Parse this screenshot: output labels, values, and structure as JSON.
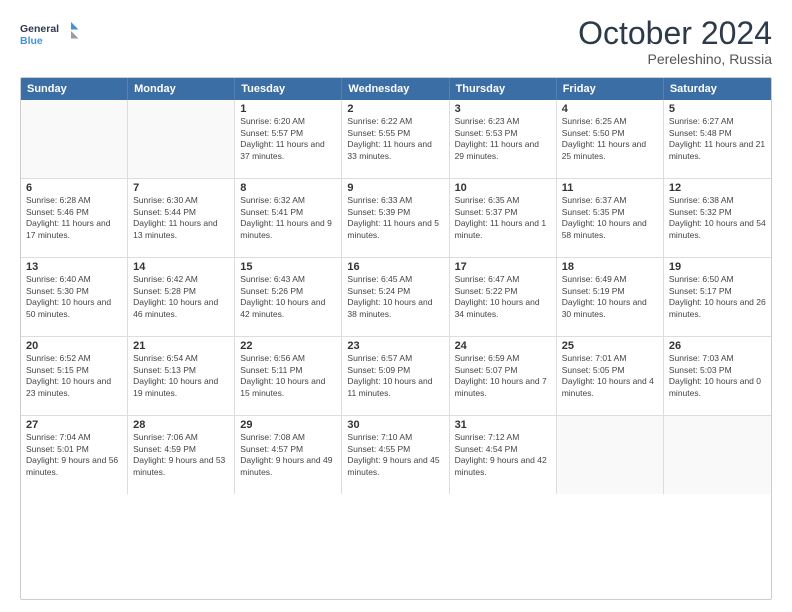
{
  "logo": {
    "line1": "General",
    "line2": "Blue"
  },
  "header": {
    "month": "October 2024",
    "location": "Pereleshino, Russia"
  },
  "days_of_week": [
    "Sunday",
    "Monday",
    "Tuesday",
    "Wednesday",
    "Thursday",
    "Friday",
    "Saturday"
  ],
  "weeks": [
    [
      {
        "day": "",
        "sunrise": "",
        "sunset": "",
        "daylight": ""
      },
      {
        "day": "",
        "sunrise": "",
        "sunset": "",
        "daylight": ""
      },
      {
        "day": "1",
        "sunrise": "Sunrise: 6:20 AM",
        "sunset": "Sunset: 5:57 PM",
        "daylight": "Daylight: 11 hours and 37 minutes."
      },
      {
        "day": "2",
        "sunrise": "Sunrise: 6:22 AM",
        "sunset": "Sunset: 5:55 PM",
        "daylight": "Daylight: 11 hours and 33 minutes."
      },
      {
        "day": "3",
        "sunrise": "Sunrise: 6:23 AM",
        "sunset": "Sunset: 5:53 PM",
        "daylight": "Daylight: 11 hours and 29 minutes."
      },
      {
        "day": "4",
        "sunrise": "Sunrise: 6:25 AM",
        "sunset": "Sunset: 5:50 PM",
        "daylight": "Daylight: 11 hours and 25 minutes."
      },
      {
        "day": "5",
        "sunrise": "Sunrise: 6:27 AM",
        "sunset": "Sunset: 5:48 PM",
        "daylight": "Daylight: 11 hours and 21 minutes."
      }
    ],
    [
      {
        "day": "6",
        "sunrise": "Sunrise: 6:28 AM",
        "sunset": "Sunset: 5:46 PM",
        "daylight": "Daylight: 11 hours and 17 minutes."
      },
      {
        "day": "7",
        "sunrise": "Sunrise: 6:30 AM",
        "sunset": "Sunset: 5:44 PM",
        "daylight": "Daylight: 11 hours and 13 minutes."
      },
      {
        "day": "8",
        "sunrise": "Sunrise: 6:32 AM",
        "sunset": "Sunset: 5:41 PM",
        "daylight": "Daylight: 11 hours and 9 minutes."
      },
      {
        "day": "9",
        "sunrise": "Sunrise: 6:33 AM",
        "sunset": "Sunset: 5:39 PM",
        "daylight": "Daylight: 11 hours and 5 minutes."
      },
      {
        "day": "10",
        "sunrise": "Sunrise: 6:35 AM",
        "sunset": "Sunset: 5:37 PM",
        "daylight": "Daylight: 11 hours and 1 minute."
      },
      {
        "day": "11",
        "sunrise": "Sunrise: 6:37 AM",
        "sunset": "Sunset: 5:35 PM",
        "daylight": "Daylight: 10 hours and 58 minutes."
      },
      {
        "day": "12",
        "sunrise": "Sunrise: 6:38 AM",
        "sunset": "Sunset: 5:32 PM",
        "daylight": "Daylight: 10 hours and 54 minutes."
      }
    ],
    [
      {
        "day": "13",
        "sunrise": "Sunrise: 6:40 AM",
        "sunset": "Sunset: 5:30 PM",
        "daylight": "Daylight: 10 hours and 50 minutes."
      },
      {
        "day": "14",
        "sunrise": "Sunrise: 6:42 AM",
        "sunset": "Sunset: 5:28 PM",
        "daylight": "Daylight: 10 hours and 46 minutes."
      },
      {
        "day": "15",
        "sunrise": "Sunrise: 6:43 AM",
        "sunset": "Sunset: 5:26 PM",
        "daylight": "Daylight: 10 hours and 42 minutes."
      },
      {
        "day": "16",
        "sunrise": "Sunrise: 6:45 AM",
        "sunset": "Sunset: 5:24 PM",
        "daylight": "Daylight: 10 hours and 38 minutes."
      },
      {
        "day": "17",
        "sunrise": "Sunrise: 6:47 AM",
        "sunset": "Sunset: 5:22 PM",
        "daylight": "Daylight: 10 hours and 34 minutes."
      },
      {
        "day": "18",
        "sunrise": "Sunrise: 6:49 AM",
        "sunset": "Sunset: 5:19 PM",
        "daylight": "Daylight: 10 hours and 30 minutes."
      },
      {
        "day": "19",
        "sunrise": "Sunrise: 6:50 AM",
        "sunset": "Sunset: 5:17 PM",
        "daylight": "Daylight: 10 hours and 26 minutes."
      }
    ],
    [
      {
        "day": "20",
        "sunrise": "Sunrise: 6:52 AM",
        "sunset": "Sunset: 5:15 PM",
        "daylight": "Daylight: 10 hours and 23 minutes."
      },
      {
        "day": "21",
        "sunrise": "Sunrise: 6:54 AM",
        "sunset": "Sunset: 5:13 PM",
        "daylight": "Daylight: 10 hours and 19 minutes."
      },
      {
        "day": "22",
        "sunrise": "Sunrise: 6:56 AM",
        "sunset": "Sunset: 5:11 PM",
        "daylight": "Daylight: 10 hours and 15 minutes."
      },
      {
        "day": "23",
        "sunrise": "Sunrise: 6:57 AM",
        "sunset": "Sunset: 5:09 PM",
        "daylight": "Daylight: 10 hours and 11 minutes."
      },
      {
        "day": "24",
        "sunrise": "Sunrise: 6:59 AM",
        "sunset": "Sunset: 5:07 PM",
        "daylight": "Daylight: 10 hours and 7 minutes."
      },
      {
        "day": "25",
        "sunrise": "Sunrise: 7:01 AM",
        "sunset": "Sunset: 5:05 PM",
        "daylight": "Daylight: 10 hours and 4 minutes."
      },
      {
        "day": "26",
        "sunrise": "Sunrise: 7:03 AM",
        "sunset": "Sunset: 5:03 PM",
        "daylight": "Daylight: 10 hours and 0 minutes."
      }
    ],
    [
      {
        "day": "27",
        "sunrise": "Sunrise: 7:04 AM",
        "sunset": "Sunset: 5:01 PM",
        "daylight": "Daylight: 9 hours and 56 minutes."
      },
      {
        "day": "28",
        "sunrise": "Sunrise: 7:06 AM",
        "sunset": "Sunset: 4:59 PM",
        "daylight": "Daylight: 9 hours and 53 minutes."
      },
      {
        "day": "29",
        "sunrise": "Sunrise: 7:08 AM",
        "sunset": "Sunset: 4:57 PM",
        "daylight": "Daylight: 9 hours and 49 minutes."
      },
      {
        "day": "30",
        "sunrise": "Sunrise: 7:10 AM",
        "sunset": "Sunset: 4:55 PM",
        "daylight": "Daylight: 9 hours and 45 minutes."
      },
      {
        "day": "31",
        "sunrise": "Sunrise: 7:12 AM",
        "sunset": "Sunset: 4:54 PM",
        "daylight": "Daylight: 9 hours and 42 minutes."
      },
      {
        "day": "",
        "sunrise": "",
        "sunset": "",
        "daylight": ""
      },
      {
        "day": "",
        "sunrise": "",
        "sunset": "",
        "daylight": ""
      }
    ]
  ]
}
